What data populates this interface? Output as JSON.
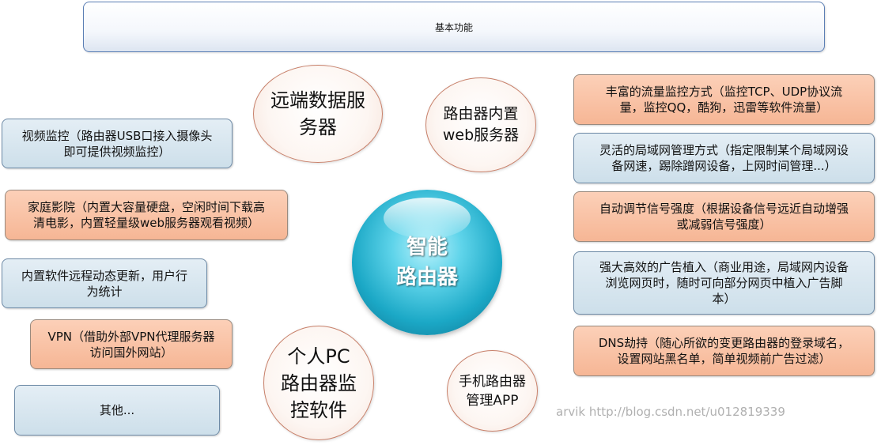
{
  "header": {
    "title": "基本功能"
  },
  "center": {
    "line1": "智能",
    "line2": "路由器"
  },
  "circles": {
    "remote_server": {
      "line1": "远端数据服",
      "line2": "务器"
    },
    "web_server": {
      "line1": "路由器内置",
      "line2": "web服务器"
    },
    "pc_software": {
      "line1": "个人PC",
      "line2": "路由器监",
      "line3": "控软件"
    },
    "mobile_app": {
      "line1": "手机路由器",
      "line2": "管理APP"
    }
  },
  "left_boxes": {
    "video": {
      "line1": "视频监控（路由器USB口接入摄像头",
      "line2": "即可提供视频监控）"
    },
    "theater": {
      "line1": "家庭影院（内置大容量硬盘，空闲时间下载高",
      "line2": "清电影，内置轻量级web服务器观看视频）"
    },
    "update": {
      "line1": "内置软件远程动态更新，用户行",
      "line2": "为统计"
    },
    "vpn": {
      "line1": "VPN（借助外部VPN代理服务器",
      "line2": "访问国外网站）"
    },
    "other": {
      "line1": "其他..."
    }
  },
  "right_boxes": {
    "traffic": {
      "line1": "丰富的流量监控方式（监控TCP、UDP协议流",
      "line2": "量，监控QQ，酷狗，迅雷等软件流量）"
    },
    "lan": {
      "line1": "灵活的局域网管理方式（指定限制某个局域网设",
      "line2": "备网速，踢除蹭网设备，上网时间管理...）"
    },
    "signal": {
      "line1": "自动调节信号强度（根据设备信号远近自动增强",
      "line2": "或减弱信号强度）"
    },
    "ads": {
      "line1": "强大高效的广告植入（商业用途，局域网内设备",
      "line2": "浏览网页时，随时可向部分网页中植入广告脚",
      "line3": "本）"
    },
    "dns": {
      "line1": "DNS劫持（随心所欲的变更路由器的登录域名，",
      "line2": "设置网站黑名单，简单视频前广告过滤）"
    }
  },
  "watermark": "arvik    http://blog.csdn.net/u012819339",
  "colors": {
    "blue_box": "#d6e6ef",
    "orange_box": "#f9c3a6",
    "center_ball": "#1ba8c6",
    "circle_border": "#c8806a"
  }
}
